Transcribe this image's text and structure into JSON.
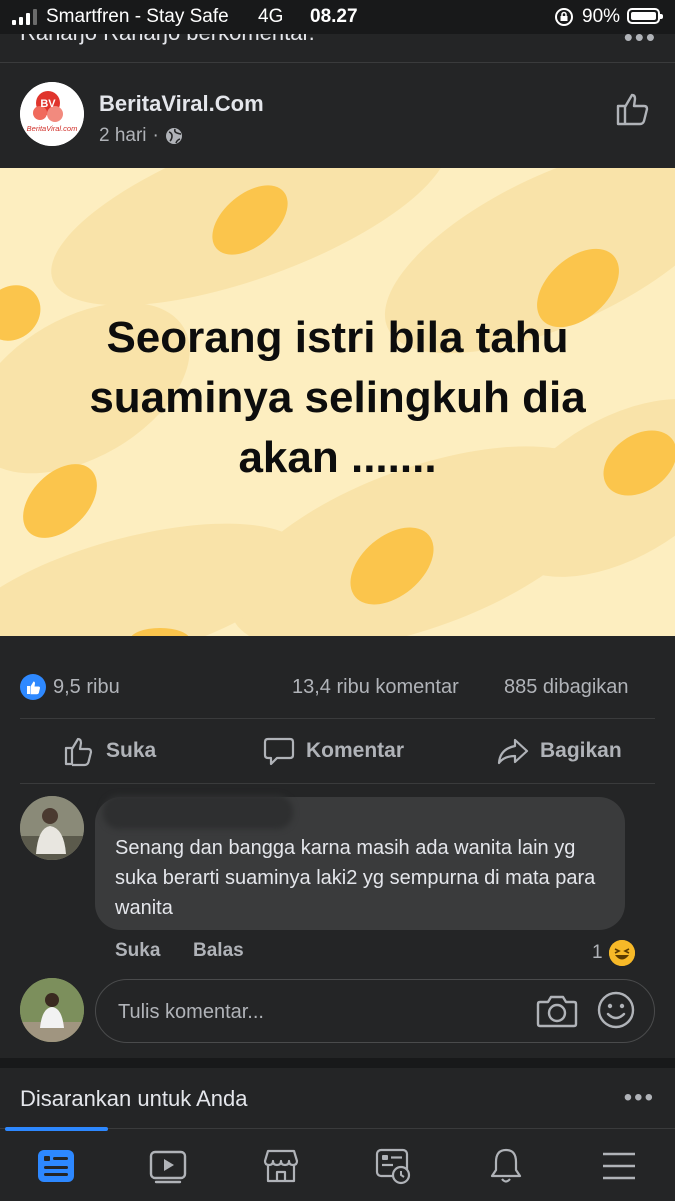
{
  "status_bar": {
    "carrier": "Smartfren - Stay Safe",
    "network": "4G",
    "time": "08.27",
    "battery_percent": "90%",
    "battery_level": 0.9
  },
  "activity_header": {
    "text": "Raharjo Raharjo berkomentar."
  },
  "post": {
    "page_name": "BeritaViral.Com",
    "logo_text": "BV",
    "logo_subtext": "BeritaViral.com",
    "time": "2 hari",
    "separator": "·",
    "image_caption": "Seorang istri bila tahu suaminya selingkuh dia akan .......",
    "image_caption_lines": [
      "Seorang istri bila tahu",
      "suaminya selingkuh dia",
      "akan ......."
    ]
  },
  "stats": {
    "likes": "9,5 ribu",
    "comments": "13,4 ribu komentar",
    "shares": "885 dibagikan"
  },
  "actions": {
    "like": "Suka",
    "comment": "Komentar",
    "share": "Bagikan"
  },
  "comment": {
    "text": "Senang dan bangga karna masih ada wanita lain yg suka berarti suaminya laki2 yg sempurna di mata para wanita",
    "like_label": "Suka",
    "reply_label": "Balas",
    "reaction_count": "1",
    "reaction_icon": "haha-emoji-icon"
  },
  "comment_input": {
    "placeholder": "Tulis komentar..."
  },
  "suggested": {
    "title": "Disarankan untuk Anda"
  },
  "tabs": [
    {
      "icon": "news-feed-icon",
      "active": true
    },
    {
      "icon": "watch-icon",
      "active": false
    },
    {
      "icon": "marketplace-icon",
      "active": false
    },
    {
      "icon": "memories-icon",
      "active": false
    },
    {
      "icon": "notifications-icon",
      "active": false
    },
    {
      "icon": "menu-icon",
      "active": false
    }
  ],
  "colors": {
    "background": "#242526",
    "accent": "#2d88ff",
    "post_bg": "#fdeec0",
    "blob": "#fbc54c"
  }
}
